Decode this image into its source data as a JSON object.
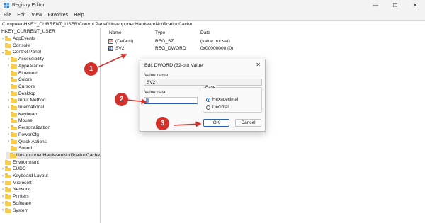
{
  "window": {
    "title": "Registry Editor",
    "controls": [
      "—",
      "☐",
      "✕"
    ]
  },
  "menu": [
    "File",
    "Edit",
    "View",
    "Favorites",
    "Help"
  ],
  "address": "Computer\\HKEY_CURRENT_USER\\Control Panel\\UnsupportedHardwareNotificationCache",
  "tree": {
    "root": "HKEY_CURRENT_USER",
    "items": [
      {
        "label": "AppEvents",
        "expandable": true
      },
      {
        "label": "Console",
        "expandable": false
      },
      {
        "label": "Control Panel",
        "expandable": true,
        "expanded": true
      },
      {
        "label": "Accessibility",
        "expandable": true,
        "child": true
      },
      {
        "label": "Appearance",
        "expandable": true,
        "child": true
      },
      {
        "label": "Bluetooth",
        "expandable": false,
        "child": true
      },
      {
        "label": "Colors",
        "expandable": false,
        "child": true
      },
      {
        "label": "Cursors",
        "expandable": false,
        "child": true
      },
      {
        "label": "Desktop",
        "expandable": true,
        "child": true
      },
      {
        "label": "Input Method",
        "expandable": true,
        "child": true
      },
      {
        "label": "International",
        "expandable": true,
        "child": true
      },
      {
        "label": "Keyboard",
        "expandable": false,
        "child": true
      },
      {
        "label": "Mouse",
        "expandable": false,
        "child": true
      },
      {
        "label": "Personalization",
        "expandable": true,
        "child": true
      },
      {
        "label": "PowerCfg",
        "expandable": true,
        "child": true
      },
      {
        "label": "Quick Actions",
        "expandable": true,
        "child": true
      },
      {
        "label": "Sound",
        "expandable": false,
        "child": true
      },
      {
        "label": "UnsupportedHardwareNotificationCache",
        "expandable": false,
        "child": true,
        "selected": true
      },
      {
        "label": "Environment",
        "expandable": false
      },
      {
        "label": "EUDC",
        "expandable": true
      },
      {
        "label": "Keyboard Layout",
        "expandable": true
      },
      {
        "label": "Microsoft",
        "expandable": true
      },
      {
        "label": "Network",
        "expandable": true
      },
      {
        "label": "Printers",
        "expandable": true
      },
      {
        "label": "Software",
        "expandable": true
      },
      {
        "label": "System",
        "expandable": true
      }
    ]
  },
  "list": {
    "headers": {
      "name": "Name",
      "type": "Type",
      "data": "Data"
    },
    "rows": [
      {
        "icon": "ab",
        "name": "(Default)",
        "type": "REG_SZ",
        "data": "(value not set)"
      },
      {
        "icon": "110",
        "name": "SV2",
        "type": "REG_DWORD",
        "data": "0x00000000 (0)"
      }
    ]
  },
  "dialog": {
    "title": "Edit DWORD (32-bit) Value",
    "close": "✕",
    "value_name_label": "Value name:",
    "value_name": "SV2",
    "value_data_label": "Value data:",
    "value_data": "",
    "base_label": "Base",
    "radio_hex": "Hexadecimal",
    "radio_dec": "Decimal",
    "selected_base": "Hexadecimal",
    "ok": "OK",
    "cancel": "Cancel"
  },
  "annotations": {
    "step1": "1",
    "step2": "2",
    "step3": "3",
    "color": "#d3312c"
  }
}
